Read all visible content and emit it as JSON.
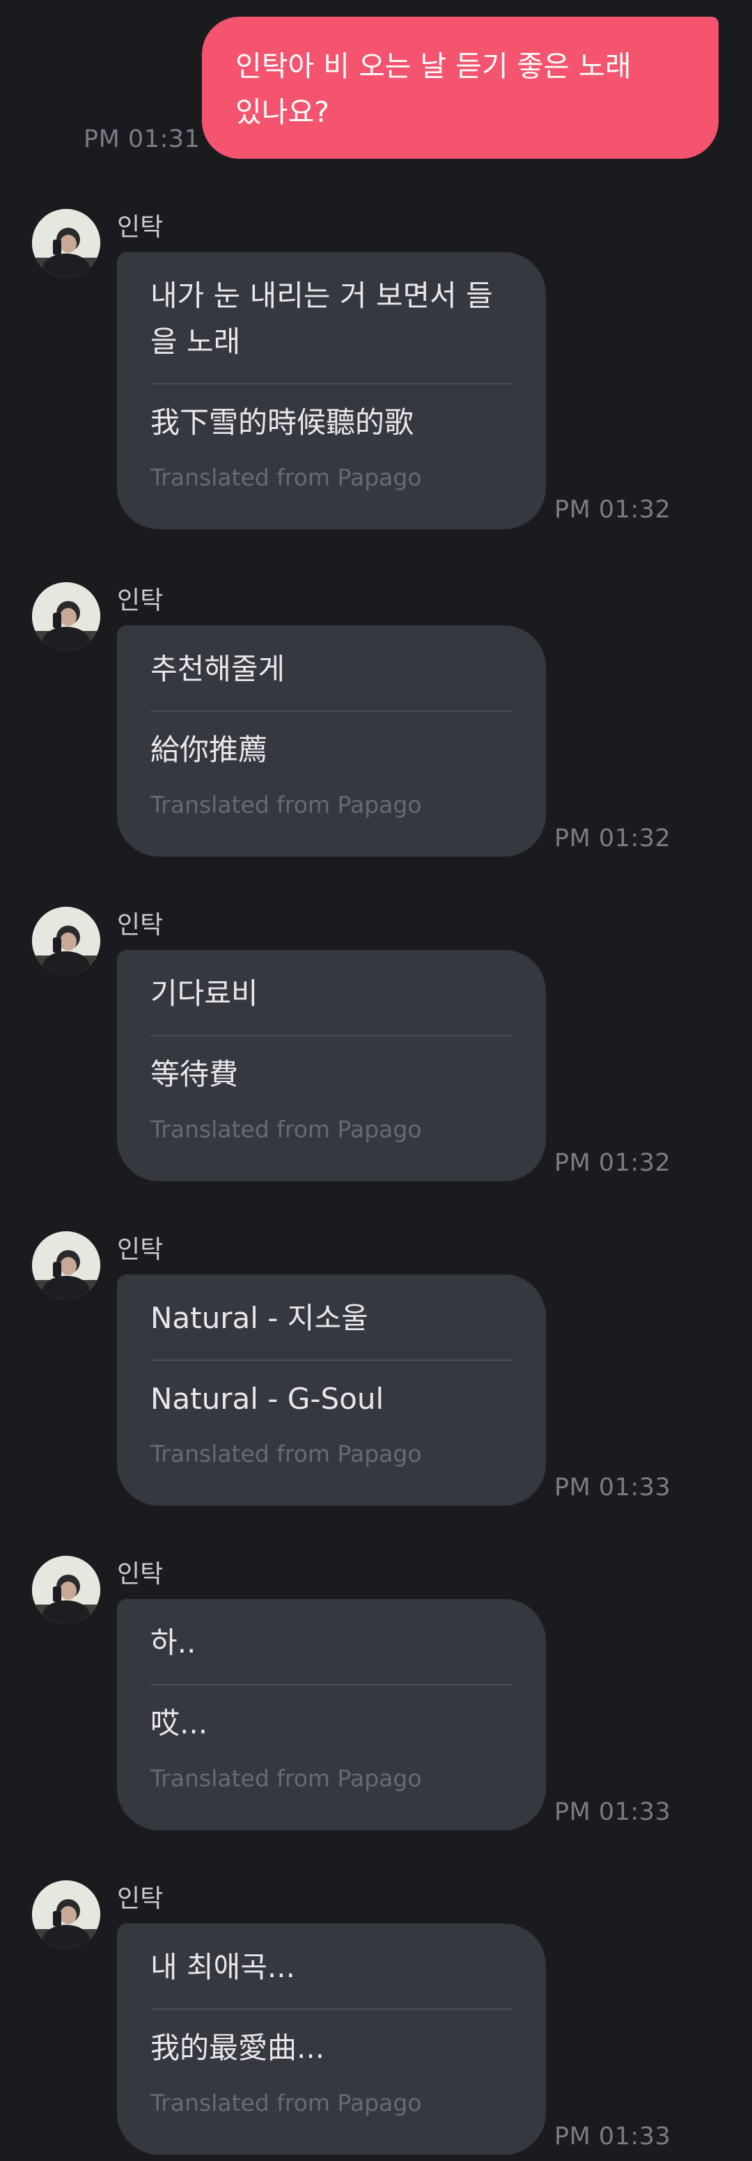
{
  "outgoing": {
    "text_line1": "인탁아 비 오는 날 듣기 좋은 노래",
    "text_line2": "있나요?",
    "time": "PM 01:31"
  },
  "incoming": [
    {
      "sender": "인탁",
      "original_line1": "내가 눈 내리는 거 보면서 들",
      "original_line2": "을 노래",
      "translation": "我下雪的時候聽的歌",
      "translated_note": "Translated from Papago",
      "time": "PM 01:32"
    },
    {
      "sender": "인탁",
      "original": "추천해줄게",
      "translation": "給你推薦",
      "translated_note": "Translated from Papago",
      "time": "PM 01:32"
    },
    {
      "sender": "인탁",
      "original": "기다료비",
      "translation": "等待費",
      "translated_note": "Translated from Papago",
      "time": "PM 01:32"
    },
    {
      "sender": "인탁",
      "original": "Natural - 지소울",
      "translation": "Natural - G-Soul",
      "translated_note": "Translated from Papago",
      "time": "PM 01:33"
    },
    {
      "sender": "인탁",
      "original": "하..",
      "translation": "哎...",
      "translated_note": "Translated from Papago",
      "time": "PM 01:33"
    },
    {
      "sender": "인탁",
      "original": "내 최애곡...",
      "translation": "我的最愛曲...",
      "translated_note": "Translated from Papago",
      "time": "PM 01:33"
    }
  ],
  "icons": {
    "avatar": "avatar-photo-icon"
  },
  "colors": {
    "background": "#1a1b1f",
    "outgoing_bubble": "#f4546e",
    "incoming_bubble": "#363840"
  }
}
